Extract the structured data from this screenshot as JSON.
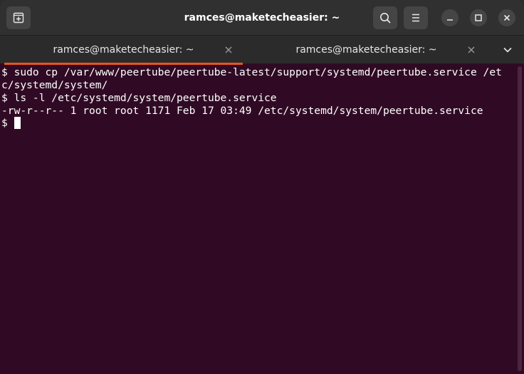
{
  "window": {
    "title": "ramces@maketecheasier: ~"
  },
  "headerbar": {
    "icons": {
      "new_tab": "new-tab-icon",
      "search": "search-icon",
      "menu": "hamburger-menu-icon",
      "minimize": "minimize-icon",
      "maximize": "maximize-icon",
      "close": "close-icon"
    }
  },
  "tabs": [
    {
      "label": "ramces@maketecheasier: ~",
      "active": true
    },
    {
      "label": "ramces@maketecheasier: ~",
      "active": false
    }
  ],
  "terminal": {
    "lines": [
      "$ sudo cp /var/www/peertube/peertube-latest/support/systemd/peertube.service /et",
      "c/systemd/system/",
      "$ ls -l /etc/systemd/system/peertube.service",
      "-rw-r--r-- 1 root root 1171 Feb 17 03:49 /etc/systemd/system/peertube.service",
      "$ "
    ]
  },
  "colors": {
    "terminal_bg": "#300a24",
    "headerbar_bg": "#303030",
    "tab_accent": "#e95420",
    "text": "#ffffff"
  }
}
